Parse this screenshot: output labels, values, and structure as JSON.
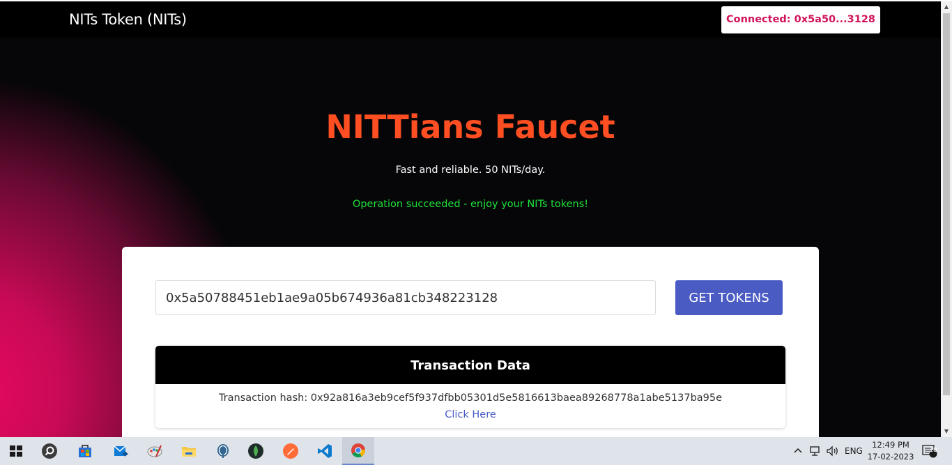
{
  "navbar": {
    "brand": "NITs Token (NITs)",
    "connect_label": "Connected: 0x5a50...3128"
  },
  "hero": {
    "title": "NITTians Faucet",
    "subtitle": "Fast and reliable. 50 NITs/day.",
    "status": "Operation succeeded - enjoy your NITs tokens!"
  },
  "form": {
    "address_value": "0x5a50788451eb1ae9a05b674936a81cb348223128",
    "button_label": "GET TOKENS"
  },
  "transaction": {
    "header": "Transaction Data",
    "hash_text": "Transaction hash: 0x92a816a3eb9cef5f937dfbb05301d5e5816613baea89268778a1abe5137ba95e",
    "link_text": "Click Here"
  },
  "taskbar": {
    "apps": [
      "windows-start-icon",
      "search-icon",
      "microsoft-store-icon",
      "mail-app-icon",
      "paint-app-icon",
      "file-explorer-icon",
      "postgres-icon",
      "mongodb-icon",
      "postman-icon",
      "vscode-icon",
      "chrome-icon"
    ],
    "language": "ENG",
    "time": "12:49 PM",
    "date": "17-02-2023",
    "notification_count": "18"
  },
  "colors": {
    "accent_title": "#ff4f22",
    "success": "#1fe23a",
    "primary_button": "#4a5bc4",
    "connect_text": "#d1135c"
  }
}
